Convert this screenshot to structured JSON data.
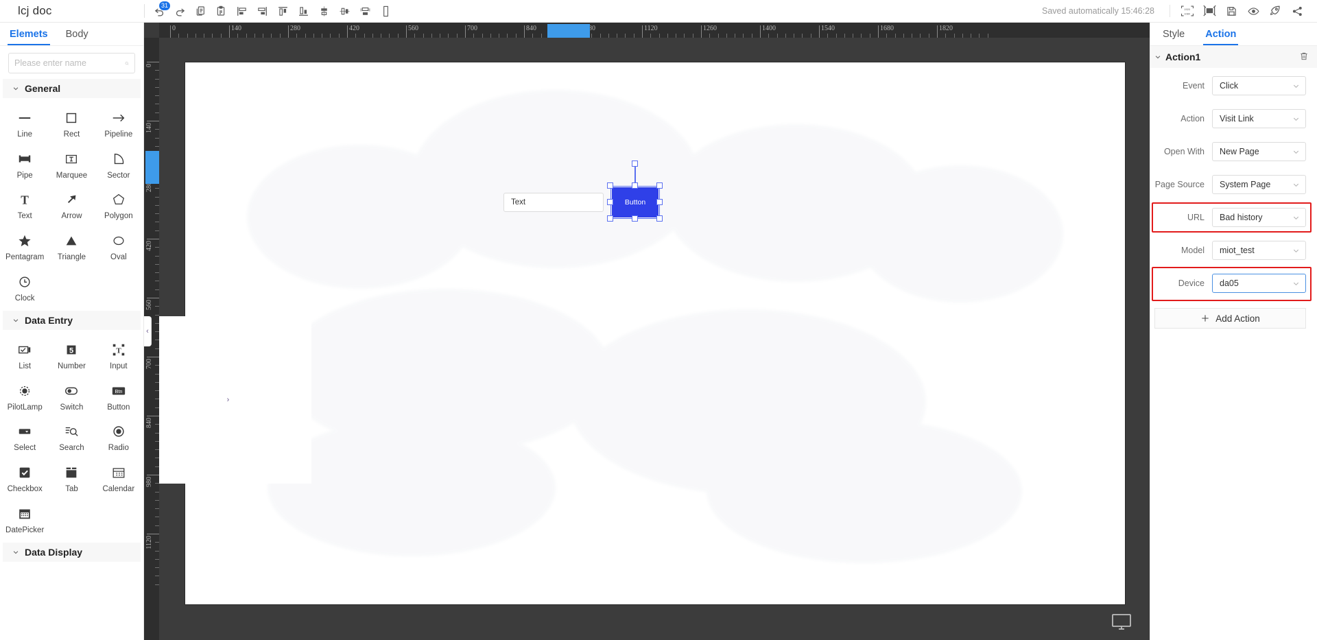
{
  "topbar": {
    "doc_title": "lcj doc",
    "undo_badge": "31",
    "saved_text": "Saved automatically 15:46:28",
    "left_icons": [
      {
        "name": "undo-icon",
        "label": "Undo"
      },
      {
        "name": "redo-icon",
        "label": "Redo"
      },
      {
        "name": "copy-icon",
        "label": "Copy"
      },
      {
        "name": "paste-icon",
        "label": "Paste"
      },
      {
        "name": "align-left-icon",
        "label": "Align left"
      },
      {
        "name": "align-right-icon",
        "label": "Align right"
      },
      {
        "name": "align-top-icon",
        "label": "Align top"
      },
      {
        "name": "align-bottom-icon",
        "label": "Align bottom"
      },
      {
        "name": "align-center-vertical-icon",
        "label": "Align center vertical"
      },
      {
        "name": "align-center-horizontal-icon",
        "label": "Align center horizontal"
      },
      {
        "name": "distribute-horizontal-icon",
        "label": "Distribute horizontally"
      },
      {
        "name": "distribute-vertical-icon",
        "label": "Distribute vertically"
      }
    ],
    "right_icons": [
      {
        "name": "canvas-size-icon",
        "label": "1920x1080"
      },
      {
        "name": "fit-screen-icon",
        "label": "Fit to screen"
      },
      {
        "name": "save-icon",
        "label": "Save"
      },
      {
        "name": "preview-icon",
        "label": "Preview"
      },
      {
        "name": "publish-icon",
        "label": "Publish"
      },
      {
        "name": "share-icon",
        "label": "Share"
      }
    ],
    "canvas_size_w": "1920",
    "canvas_size_h": "1080"
  },
  "left_panel": {
    "tabs": [
      {
        "label": "Elemets",
        "active": true
      },
      {
        "label": "Body",
        "active": false
      }
    ],
    "search_placeholder": "Please enter name",
    "search_value": "",
    "sections": [
      {
        "title": "General",
        "expanded": true,
        "items": [
          {
            "label": "Line",
            "icon": "line-icon"
          },
          {
            "label": "Rect",
            "icon": "rect-icon"
          },
          {
            "label": "Pipeline",
            "icon": "pipeline-icon"
          },
          {
            "label": "Pipe",
            "icon": "pipe-icon"
          },
          {
            "label": "Marquee",
            "icon": "marquee-icon"
          },
          {
            "label": "Sector",
            "icon": "sector-icon"
          },
          {
            "label": "Text",
            "icon": "text-icon"
          },
          {
            "label": "Arrow",
            "icon": "arrow-icon"
          },
          {
            "label": "Polygon",
            "icon": "polygon-icon"
          },
          {
            "label": "Pentagram",
            "icon": "pentagram-icon"
          },
          {
            "label": "Triangle",
            "icon": "triangle-icon"
          },
          {
            "label": "Oval",
            "icon": "oval-icon"
          },
          {
            "label": "Clock",
            "icon": "clock-icon"
          }
        ]
      },
      {
        "title": "Data Entry",
        "expanded": true,
        "items": [
          {
            "label": "List",
            "icon": "list-icon"
          },
          {
            "label": "Number",
            "icon": "number-icon"
          },
          {
            "label": "Input",
            "icon": "input-icon"
          },
          {
            "label": "PilotLamp",
            "icon": "pilotlamp-icon"
          },
          {
            "label": "Switch",
            "icon": "switch-icon"
          },
          {
            "label": "Button",
            "icon": "button-icon"
          },
          {
            "label": "Select",
            "icon": "select-icon"
          },
          {
            "label": "Search",
            "icon": "search-icon"
          },
          {
            "label": "Radio",
            "icon": "radio-icon"
          },
          {
            "label": "Checkbox",
            "icon": "checkbox-icon"
          },
          {
            "label": "Tab",
            "icon": "tab-icon"
          },
          {
            "label": "Calendar",
            "icon": "calendar-icon"
          },
          {
            "label": "DatePicker",
            "icon": "datepicker-icon"
          }
        ]
      },
      {
        "title": "Data Display",
        "expanded": true,
        "items": []
      }
    ]
  },
  "canvas": {
    "ruler_h_labels": [
      "0",
      "140",
      "280",
      "420",
      "560",
      "700",
      "840",
      "980",
      "1120",
      "1260",
      "1400",
      "1540",
      "1680",
      "1820"
    ],
    "ruler_v_labels": [
      "0",
      "140",
      "280",
      "420",
      "560",
      "700",
      "840",
      "980",
      "1120"
    ],
    "highlight_h_label": "980",
    "highlight_v_label": "280",
    "elements": [
      {
        "type": "text-input",
        "label": "Text",
        "selected": false
      },
      {
        "type": "button",
        "label": "Button",
        "selected": true
      }
    ],
    "collapse_left": "‹",
    "collapse_right": "›",
    "monitor_icon": "monitor-icon"
  },
  "right_panel": {
    "tabs": [
      {
        "label": "Style",
        "active": false
      },
      {
        "label": "Action",
        "active": true
      }
    ],
    "action_title": "Action1",
    "delete_icon": "trash-icon",
    "fields": [
      {
        "label": "Event",
        "value": "Click",
        "highlight": false,
        "focused": false
      },
      {
        "label": "Action",
        "value": "Visit Link",
        "highlight": false,
        "focused": false
      },
      {
        "label": "Open With",
        "value": "New Page",
        "highlight": false,
        "focused": false
      },
      {
        "label": "Page Source",
        "value": "System Page",
        "highlight": false,
        "focused": false
      },
      {
        "label": "URL",
        "value": "Bad history",
        "highlight": true,
        "focused": false
      },
      {
        "label": "Model",
        "value": "miot_test",
        "highlight": false,
        "focused": false
      },
      {
        "label": "Device",
        "value": "da05",
        "highlight": true,
        "focused": true
      }
    ],
    "add_action_label": "Add Action",
    "add_icon": "plus-icon"
  },
  "colors": {
    "accent": "#1a73e8",
    "highlight_red": "#e21b1b",
    "button_blue": "#2f40e8",
    "selection_blue": "#5a6ff0",
    "ruler_highlight": "#3e9bea"
  }
}
